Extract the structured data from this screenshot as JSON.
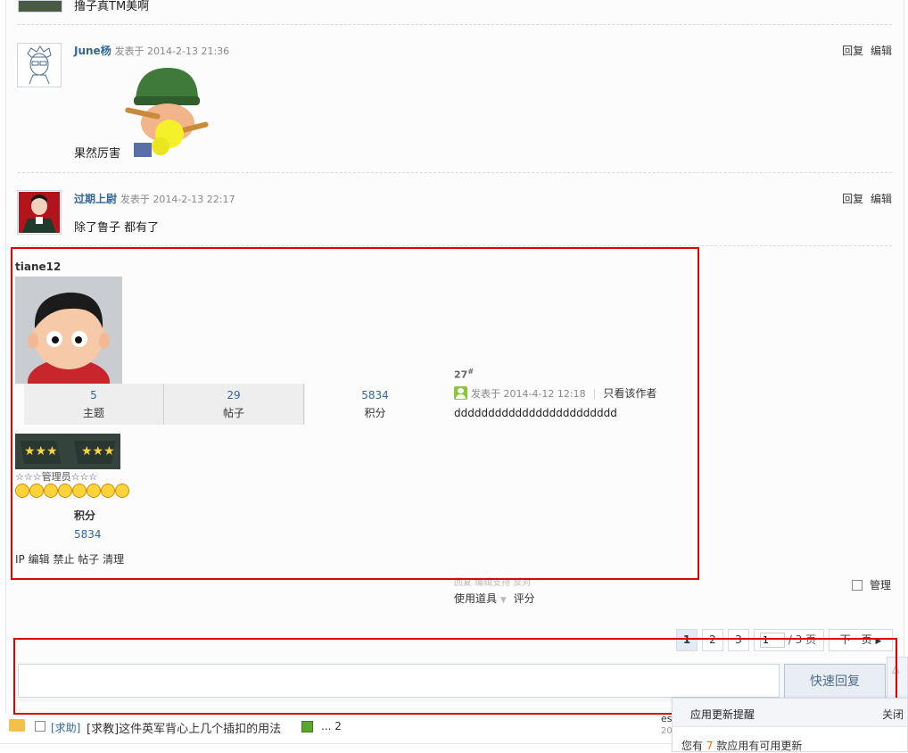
{
  "top_post": {
    "message": "撸子真TM美啊"
  },
  "posts": [
    {
      "author": "June杨",
      "meta": "发表于 2014-2-13 21:36",
      "message": "果然厉害",
      "reply": "回复",
      "edit": "编辑"
    },
    {
      "author": "过期上尉",
      "meta": "发表于 2014-2-13 22:17",
      "message": "除了鲁子 都有了",
      "reply": "回复",
      "edit": "编辑"
    }
  ],
  "main_post": {
    "username": "tiane12",
    "stats": [
      {
        "value": "5",
        "label": "主题"
      },
      {
        "value": "29",
        "label": "帖子"
      },
      {
        "value": "5834",
        "label": "积分"
      }
    ],
    "rank": "☆☆☆管理员☆☆☆",
    "credits_label": "积分",
    "credits_value": "5834",
    "admin_links": [
      "IP",
      "编辑",
      "禁止",
      "帖子",
      "清理"
    ],
    "floor": "27",
    "floor_mark": "#",
    "posted": "发表于 2014-4-12 12:18",
    "only_author": "只看该作者",
    "content": "dddddddddddddddddddddddd",
    "faded_actions": "回复 编辑支持 反对",
    "use_tool": "使用道具",
    "rate": "评分",
    "manage": "管理"
  },
  "pagination": {
    "pages": [
      "1",
      "2",
      "3"
    ],
    "current": "1",
    "input_value": "1",
    "total": "/ 3 页",
    "next": "下一页"
  },
  "quick_reply": {
    "placeholder": "",
    "button": "快速回复"
  },
  "thread_item": {
    "tag": "[求助]",
    "title": "[求教]这件英军背心上几个插扣的用法",
    "pages": "... 2",
    "side_a": "es",
    "side_b": "20"
  },
  "notice": {
    "title": "应用更新提醒",
    "close": "关闭",
    "text_before": "您有",
    "count": "7",
    "text_after": "款应用有可用更新"
  },
  "colors": {
    "link": "#336699",
    "highlight": "#e10000",
    "accent_orange": "#ff6600"
  }
}
